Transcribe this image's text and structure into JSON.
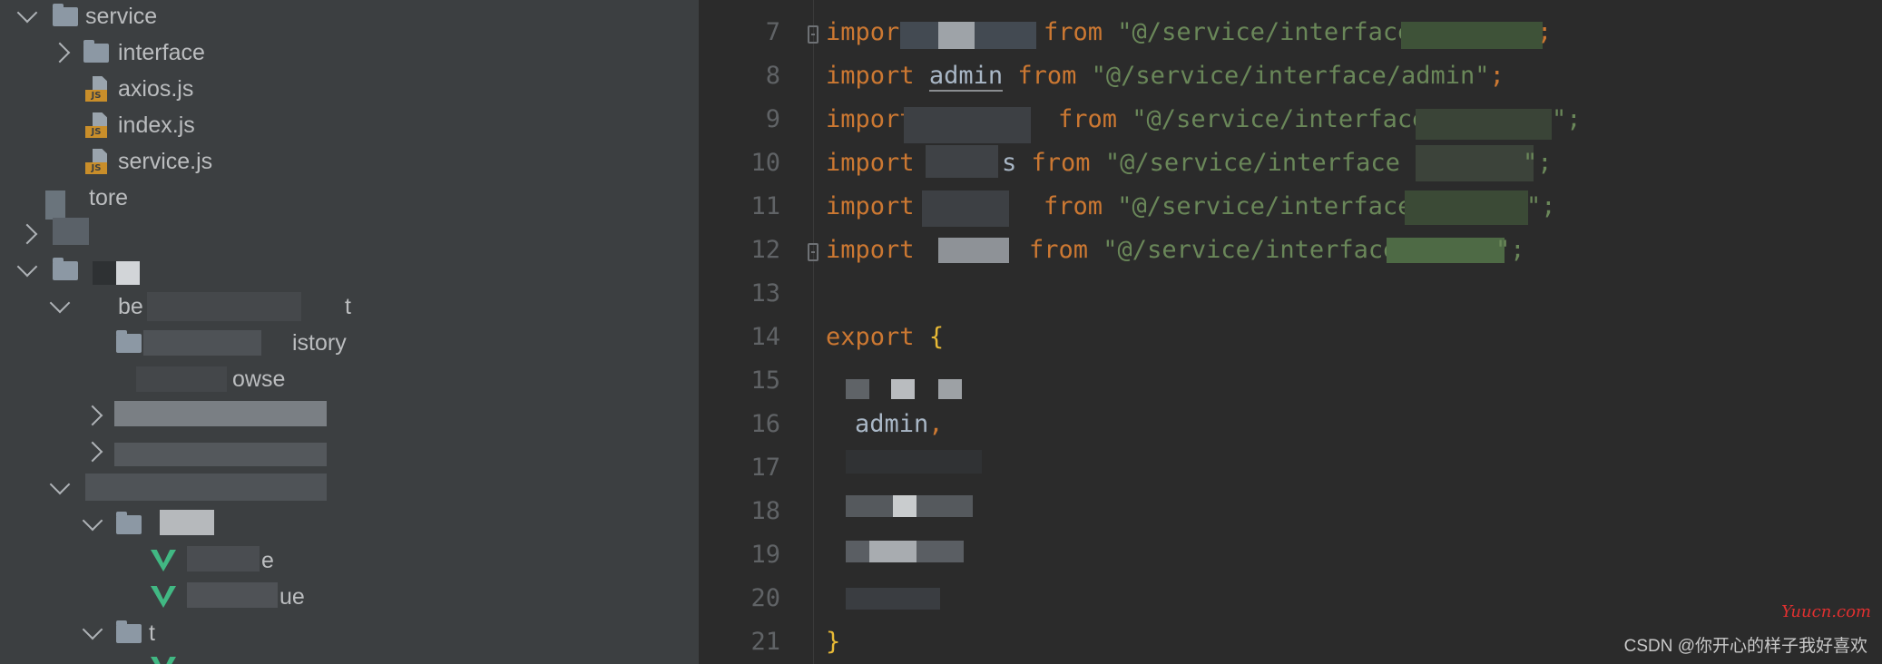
{
  "project_tree": {
    "items": [
      {
        "label": "service",
        "icon": "folder-icon",
        "expanded": true
      },
      {
        "label": "interface",
        "icon": "folder-icon",
        "expanded": false
      },
      {
        "label": "axios.js",
        "icon": "js-file-icon"
      },
      {
        "label": "index.js",
        "icon": "js-file-icon"
      },
      {
        "label": "service.js",
        "icon": "js-file-icon"
      },
      {
        "label": "tore",
        "icon": "folder-icon"
      },
      {
        "label": "",
        "icon": "folder-icon"
      },
      {
        "label": "",
        "icon": "folder-icon",
        "expanded": true
      },
      {
        "label": "be",
        "suffix": "t",
        "icon": "folder-icon",
        "expanded": true
      },
      {
        "label": "istory",
        "icon": "folder-icon"
      },
      {
        "label": "owse",
        "icon": "folder-icon"
      },
      {
        "label": "",
        "icon": "folder-icon"
      },
      {
        "label": "",
        "icon": "folder-icon"
      },
      {
        "label": "",
        "icon": "folder-icon",
        "expanded": true
      },
      {
        "label": "",
        "icon": "folder-icon",
        "expanded": true
      },
      {
        "label": "e",
        "icon": "vue-file-icon"
      },
      {
        "label": "ue",
        "icon": "vue-file-icon"
      },
      {
        "label": "t",
        "icon": "folder-icon",
        "expanded": true
      },
      {
        "label": "",
        "icon": "vue-file-icon"
      }
    ],
    "js_badge": "JS"
  },
  "editor": {
    "line_numbers": [
      "7",
      "8",
      "9",
      "10",
      "11",
      "12",
      "13",
      "14",
      "15",
      "16",
      "17",
      "18",
      "19",
      "20",
      "21"
    ],
    "line8": {
      "kw_import": "import",
      "name": "admin",
      "kw_from": "from",
      "path": "\"@/service/interface/admin\"",
      "semi": ";"
    },
    "line7": {
      "kw_import": "import",
      "kw_from": "from",
      "path": "\"@/service/interface",
      "end": ";"
    },
    "line9": {
      "kw_import": "import",
      "kw_from": "from",
      "path": "\"@/service/interface",
      "end": "\";"
    },
    "line10": {
      "kw_import": "import",
      "frag": "s",
      "kw_from": "from",
      "path": "\"@/service/interface",
      "end": "\";"
    },
    "line11": {
      "kw_import": "import",
      "kw_from": "from",
      "path": "\"@/service/interface",
      "end": "\";"
    },
    "line12": {
      "kw_import": "import",
      "kw_from": "from",
      "path": "\"@/service/interface",
      "end": "\";"
    },
    "line14": {
      "kw_export": "export",
      "brace": "{"
    },
    "line16": {
      "name": "admin",
      "comma": ","
    },
    "line21": {
      "brace": "}"
    }
  },
  "watermarks": {
    "site": "Yuucn.com",
    "author": "CSDN @你开心的样子我好喜欢"
  },
  "colors": {
    "keyword": "#cc7832",
    "string": "#6a8759",
    "identifier": "#a9b7c6",
    "brace": "#e8ba36",
    "line_number": "#606366"
  }
}
